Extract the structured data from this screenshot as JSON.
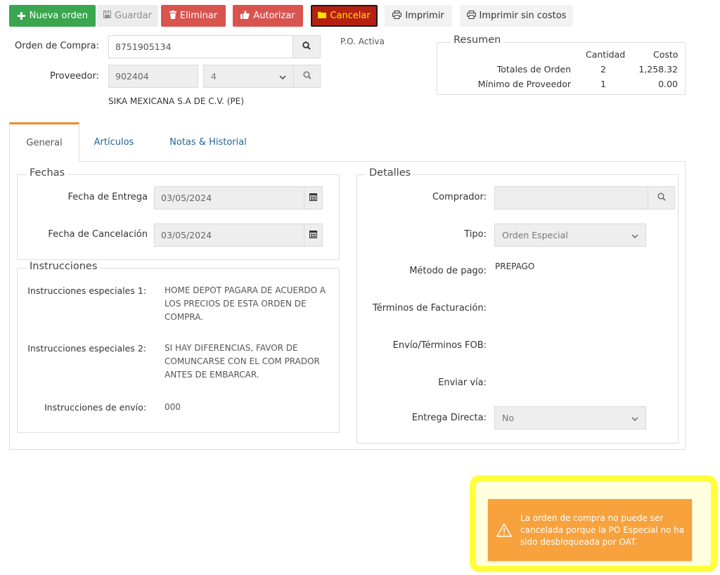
{
  "toolbar": {
    "new_order": "Nueva orden",
    "save": "Guardar",
    "delete": "Eliminar",
    "authorize": "Autorizar",
    "cancel": "Cancelar",
    "print": "Imprimir",
    "print_no_costs": "Imprimir sin costos"
  },
  "header": {
    "po_label": "Orden de Compra:",
    "po_value": "8751905134",
    "supplier_label": "Proveedor:",
    "supplier_code": "902404",
    "supplier_select": "4",
    "supplier_name": "SIKA MEXICANA S.A DE C.V. (PE)",
    "po_status": "P.O. Activa"
  },
  "summary": {
    "title": "Resumen",
    "col_qty": "Cantidad",
    "col_cost": "Costo",
    "rows": [
      {
        "label": "Totales de Orden",
        "qty": "2",
        "cost": "1,258.32"
      },
      {
        "label": "Mínimo de Proveedor",
        "qty": "1",
        "cost": "0.00"
      }
    ]
  },
  "tabs": [
    {
      "label": "General",
      "active": true
    },
    {
      "label": "Artículos",
      "active": false
    },
    {
      "label": "Notas & Historial",
      "active": false
    }
  ],
  "fechas": {
    "title": "Fechas",
    "delivery_label": "Fecha de Entrega",
    "delivery_value": "03/05/2024",
    "cancel_label": "Fecha de Cancelación",
    "cancel_value": "03/05/2024"
  },
  "instrucciones": {
    "title": "Instrucciones",
    "special1_label": "Instrucciones especiales 1:",
    "special1_value": "HOME DEPOT PAGARA DE ACUERDO A\nLOS PRECIOS DE ESTA ORDEN DE\nCOMPRA.",
    "special2_label": "Instrucciones especiales 2:",
    "special2_value": "SI HAY DIFERENCIAS, FAVOR DE\nCOMUNCARSE CON EL COM PRADOR\nANTES DE EMBARCAR.",
    "shipping_label": "Instrucciones de envío:",
    "shipping_value": "000"
  },
  "detalles": {
    "title": "Detalles",
    "buyer_label": "Comprador:",
    "buyer_value": "",
    "type_label": "Tipo:",
    "type_value": "Orden Especial",
    "payment_label": "Método de pago:",
    "payment_value": "PREPAGO",
    "billing_label": "Términos de Facturación:",
    "fob_label": "Envío/Términos FOB:",
    "shipvia_label": "Enviar vía:",
    "direct_label": "Entrega Directa:",
    "direct_value": "No"
  },
  "toast": {
    "message": "La orden de compra no puede ser cancelada porque la PO Especial no ha sido desbloqueada por OAT."
  },
  "colors": {
    "green": "#3aa64f",
    "red": "#d9534f",
    "cancel_bg": "#b72011",
    "cancel_text": "#ffe100",
    "tab_accent": "#f0882b",
    "toast": "#f7a23c",
    "highlight": "#ffff3a",
    "link": "#2a6496"
  },
  "icons": [
    "plus-icon",
    "save-icon",
    "trash-icon",
    "thumbs-up-icon",
    "folder-icon",
    "print-icon",
    "search-icon",
    "calendar-icon",
    "chevron-down-icon",
    "warning-icon"
  ]
}
